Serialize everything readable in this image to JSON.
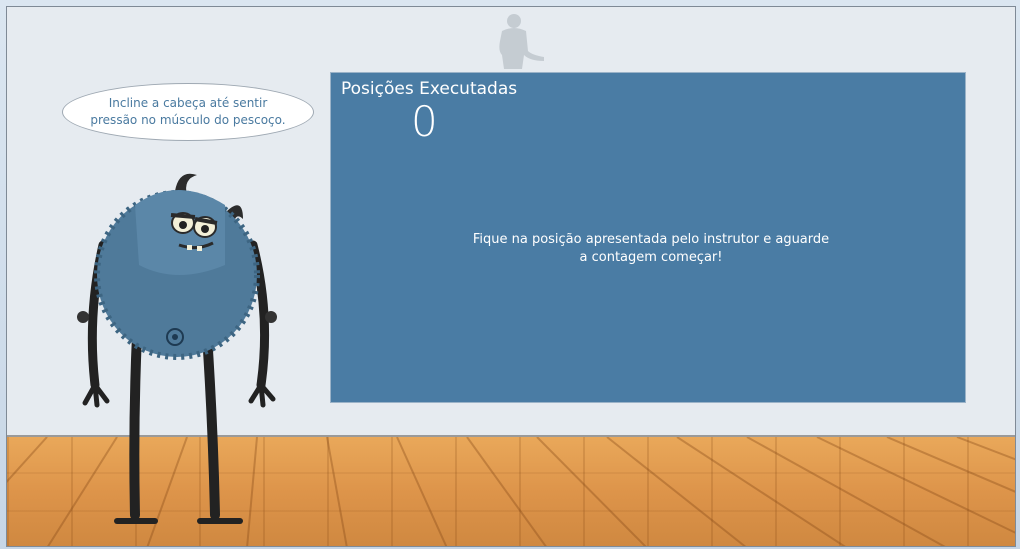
{
  "speech_bubble": {
    "text": "Incline a cabeça até sentir pressão no músculo do pescoço."
  },
  "panel": {
    "title": "Posições Executadas",
    "count": "0",
    "message": "Fique na posição apresentada pelo instrutor e aguarde a contagem começar!"
  },
  "icons": {
    "instructor": "instructor-silhouette-icon",
    "character": "blue-monster-character"
  },
  "colors": {
    "panel": "#4a7ca4",
    "wall": "#e6ebf0",
    "floor": "#dd944a",
    "bubble_text": "#4a7aa0"
  }
}
